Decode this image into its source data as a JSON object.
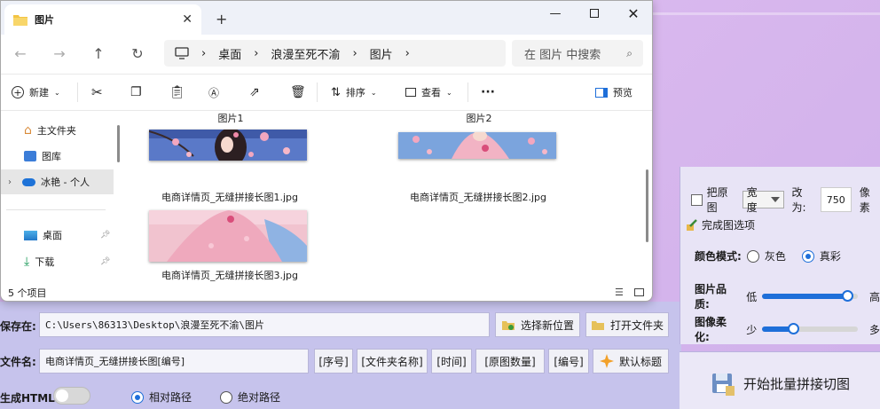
{
  "explorer": {
    "tab_title": "图片",
    "breadcrumb": [
      "桌面",
      "浪漫至死不渝",
      "图片"
    ],
    "search_placeholder": "在 图片 中搜索",
    "commands": {
      "new": "新建",
      "sort": "排序",
      "view": "查看",
      "more": "···",
      "preview": "预览"
    },
    "nav": {
      "home": "主文件夹",
      "gallery": "图库",
      "onedrive": "冰艳 - 个人",
      "desktop": "桌面",
      "downloads": "下载"
    },
    "groups": [
      "图片1",
      "图片2"
    ],
    "files": [
      "电商详情页_无缝拼接长图1.jpg",
      "电商详情页_无缝拼接长图2.jpg",
      "电商详情页_无缝拼接长图3.jpg"
    ],
    "status": "5 个项目"
  },
  "app": {
    "original_label": "把原图",
    "width_option": "宽度",
    "change_to": "改为:",
    "size_value": "750",
    "pixel_unit": "像素",
    "output_options_title": "完成图选项",
    "color_mode_label": "颜色模式:",
    "gray": "灰色",
    "true_color": "真彩",
    "quality_label": "图片品质:",
    "low": "低",
    "high": "高",
    "quality_level": 0.95,
    "soften_label": "图像柔化:",
    "less": "少",
    "more": "多",
    "soften_level": 0.3,
    "save_label": "保存在:",
    "save_path": "C:\\Users\\86313\\Desktop\\浪漫至死不渝\\图片",
    "choose_location": "选择新位置",
    "open_folder": "打开文件夹",
    "filename_label": "文件名:",
    "filename_value": "电商详情页_无缝拼接长图[编号]",
    "tokens": [
      "[序号]",
      "[文件夹名称]",
      "[时间]",
      "[原图数量]",
      "[编号]"
    ],
    "default_title": "默认标题",
    "gen_html_label": "生成HTML:",
    "relative_path": "相对路径",
    "absolute_path": "绝对路径",
    "start_button": "开始批量拼接切图"
  },
  "colors": {
    "accent": "#1e6fd9",
    "background": "#d2b2ea",
    "lower_panel": "#c6c3ec"
  }
}
